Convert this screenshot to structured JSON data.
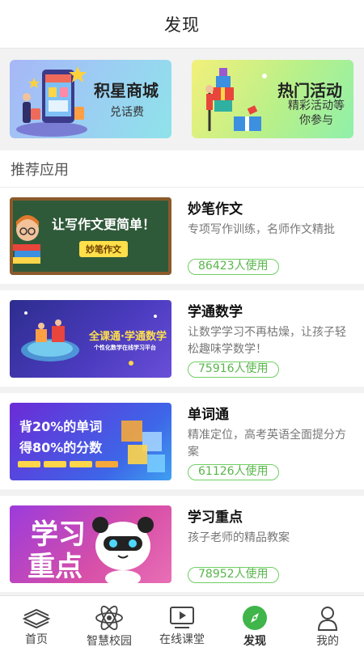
{
  "header": {
    "title": "发现"
  },
  "banners": [
    {
      "title": "积星商城",
      "subtitle": "兑话费"
    },
    {
      "title": "热门活动",
      "subtitle": "精彩活动等你参与"
    }
  ],
  "section": {
    "title": "推荐应用"
  },
  "apps": [
    {
      "name": "妙笔作文",
      "desc": "专项写作训练，名师作文精批",
      "usage": "86423人使用",
      "thumb_text": "让写作文更简单！",
      "thumb_tag": "妙笔作文"
    },
    {
      "name": "学通数学",
      "desc": "让数学学习不再枯燥，让孩子轻松趣味学数学！",
      "usage": "75916人使用",
      "thumb_text": "全课通·学通数学",
      "thumb_tag": "个性化数学在线学习平台"
    },
    {
      "name": "单词通",
      "desc": "精准定位，高考英语全面提分方案",
      "usage": "61126人使用",
      "thumb_text": "背20%的单词",
      "thumb_tag": "得80%的分数"
    },
    {
      "name": "学习重点",
      "desc": "孩子老师的精品教案",
      "usage": "78952人使用",
      "thumb_text": "学习",
      "thumb_tag": "重点"
    }
  ],
  "tabs": [
    {
      "label": "首页",
      "icon": "books-icon"
    },
    {
      "label": "智慧校园",
      "icon": "atom-icon"
    },
    {
      "label": "在线课堂",
      "icon": "play-icon"
    },
    {
      "label": "发现",
      "icon": "compass-icon",
      "active": true
    },
    {
      "label": "我的",
      "icon": "person-icon"
    }
  ],
  "colors": {
    "accent": "#59b54b",
    "active_tab": "#3fb54a"
  }
}
